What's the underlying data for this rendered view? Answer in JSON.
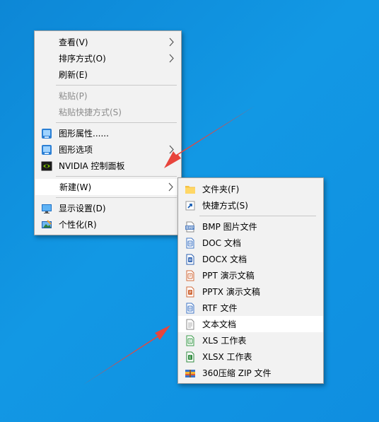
{
  "context_menu": {
    "items": [
      {
        "label": "查看(V)"
      },
      {
        "label": "排序方式(O)"
      },
      {
        "label": "刷新(E)"
      },
      {
        "label": "粘贴(P)"
      },
      {
        "label": "粘贴快捷方式(S)"
      },
      {
        "label": "图形属性......"
      },
      {
        "label": "图形选项"
      },
      {
        "label": "NVIDIA 控制面板"
      },
      {
        "label": "新建(W)"
      },
      {
        "label": "显示设置(D)"
      },
      {
        "label": "个性化(R)"
      }
    ]
  },
  "new_submenu": {
    "items": [
      {
        "label": "文件夹(F)"
      },
      {
        "label": "快捷方式(S)"
      },
      {
        "label": "BMP 图片文件"
      },
      {
        "label": "DOC 文档"
      },
      {
        "label": "DOCX 文档"
      },
      {
        "label": "PPT 演示文稿"
      },
      {
        "label": "PPTX 演示文稿"
      },
      {
        "label": "RTF 文件"
      },
      {
        "label": "文本文档"
      },
      {
        "label": "XLS 工作表"
      },
      {
        "label": "XLSX 工作表"
      },
      {
        "label": "360压缩 ZIP 文件"
      }
    ]
  },
  "colors": {
    "desktop": "#0f8fe0",
    "menu_bg": "#f2f2f2",
    "highlight": "#ffffff",
    "annotation_arrow": "#e8453c"
  }
}
